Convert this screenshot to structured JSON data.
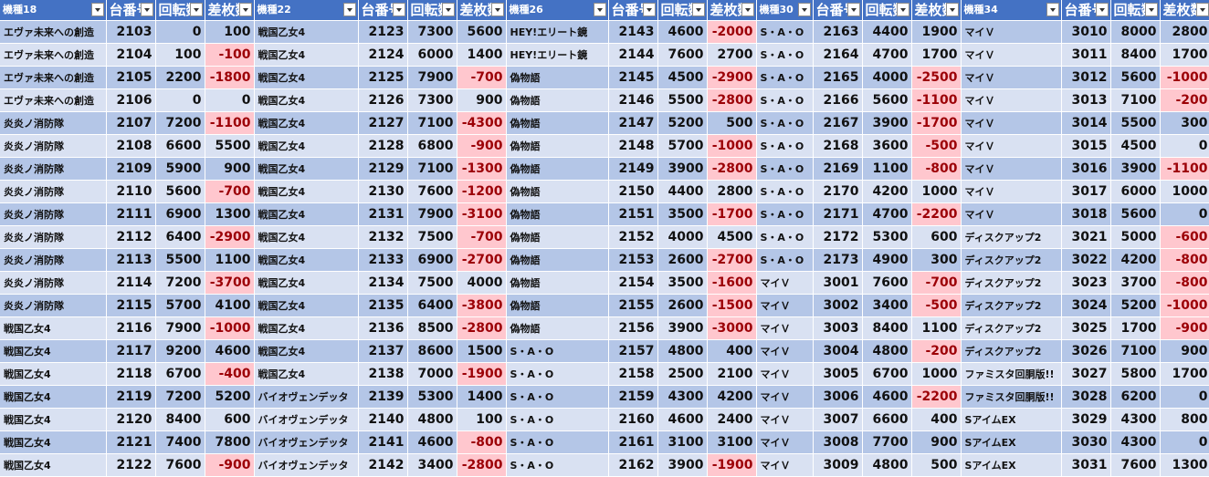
{
  "colors": {
    "header_bg": "#4472c4",
    "band_dark": "#b4c6e7",
    "band_light": "#d9e1f2",
    "negative_fill": "#ffc7ce",
    "negative_text": "#9c0006"
  },
  "headers": [
    {
      "model": "機種18",
      "unit": "台番号",
      "spins": "回転数",
      "diff": "差枚数"
    },
    {
      "model": "機種22",
      "unit": "台番号",
      "spins": "回転数",
      "diff": "差枚数"
    },
    {
      "model": "機種26",
      "unit": "台番号",
      "spins": "回転数",
      "diff": "差枚数"
    },
    {
      "model": "機種30",
      "unit": "台番号",
      "spins": "回転数",
      "diff": "差枚数"
    },
    {
      "model": "機種34",
      "unit": "台番号",
      "spins": "回転数",
      "diff": "差枚数"
    }
  ],
  "rows": [
    [
      [
        "エヴァ未来への創造",
        "2103",
        "0",
        "100"
      ],
      [
        "戦国乙女4",
        "2123",
        "7300",
        "5600"
      ],
      [
        "HEY!エリート鏡",
        "2143",
        "4600",
        "-2000"
      ],
      [
        "S・A・O",
        "2163",
        "4400",
        "1900"
      ],
      [
        "マイＶ",
        "3010",
        "8000",
        "2800"
      ]
    ],
    [
      [
        "エヴァ未来への創造",
        "2104",
        "100",
        "-100"
      ],
      [
        "戦国乙女4",
        "2124",
        "6000",
        "1400"
      ],
      [
        "HEY!エリート鏡",
        "2144",
        "7600",
        "2700"
      ],
      [
        "S・A・O",
        "2164",
        "4700",
        "1700"
      ],
      [
        "マイＶ",
        "3011",
        "8400",
        "1700"
      ]
    ],
    [
      [
        "エヴァ未来への創造",
        "2105",
        "2200",
        "-1800"
      ],
      [
        "戦国乙女4",
        "2125",
        "7900",
        "-700"
      ],
      [
        "偽物語",
        "2145",
        "4500",
        "-2900"
      ],
      [
        "S・A・O",
        "2165",
        "4000",
        "-2500"
      ],
      [
        "マイＶ",
        "3012",
        "5600",
        "-1000"
      ]
    ],
    [
      [
        "エヴァ未来への創造",
        "2106",
        "0",
        "0"
      ],
      [
        "戦国乙女4",
        "2126",
        "7300",
        "900"
      ],
      [
        "偽物語",
        "2146",
        "5500",
        "-2800"
      ],
      [
        "S・A・O",
        "2166",
        "5600",
        "-1100"
      ],
      [
        "マイＶ",
        "3013",
        "7100",
        "-200"
      ]
    ],
    [
      [
        "炎炎ノ消防隊",
        "2107",
        "7200",
        "-1100"
      ],
      [
        "戦国乙女4",
        "2127",
        "7100",
        "-4300"
      ],
      [
        "偽物語",
        "2147",
        "5200",
        "500"
      ],
      [
        "S・A・O",
        "2167",
        "3900",
        "-1700"
      ],
      [
        "マイＶ",
        "3014",
        "5500",
        "300"
      ]
    ],
    [
      [
        "炎炎ノ消防隊",
        "2108",
        "6600",
        "5500"
      ],
      [
        "戦国乙女4",
        "2128",
        "6800",
        "-900"
      ],
      [
        "偽物語",
        "2148",
        "5700",
        "-1000"
      ],
      [
        "S・A・O",
        "2168",
        "3600",
        "-500"
      ],
      [
        "マイＶ",
        "3015",
        "4500",
        "0"
      ]
    ],
    [
      [
        "炎炎ノ消防隊",
        "2109",
        "5900",
        "900"
      ],
      [
        "戦国乙女4",
        "2129",
        "7100",
        "-1300"
      ],
      [
        "偽物語",
        "2149",
        "3900",
        "-2800"
      ],
      [
        "S・A・O",
        "2169",
        "1100",
        "-800"
      ],
      [
        "マイＶ",
        "3016",
        "3900",
        "-1100"
      ]
    ],
    [
      [
        "炎炎ノ消防隊",
        "2110",
        "5600",
        "-700"
      ],
      [
        "戦国乙女4",
        "2130",
        "7600",
        "-1200"
      ],
      [
        "偽物語",
        "2150",
        "4400",
        "2800"
      ],
      [
        "S・A・O",
        "2170",
        "4200",
        "1000"
      ],
      [
        "マイＶ",
        "3017",
        "6000",
        "1000"
      ]
    ],
    [
      [
        "炎炎ノ消防隊",
        "2111",
        "6900",
        "1300"
      ],
      [
        "戦国乙女4",
        "2131",
        "7900",
        "-3100"
      ],
      [
        "偽物語",
        "2151",
        "3500",
        "-1700"
      ],
      [
        "S・A・O",
        "2171",
        "4700",
        "-2200"
      ],
      [
        "マイＶ",
        "3018",
        "5600",
        "0"
      ]
    ],
    [
      [
        "炎炎ノ消防隊",
        "2112",
        "6400",
        "-2900"
      ],
      [
        "戦国乙女4",
        "2132",
        "7500",
        "-700"
      ],
      [
        "偽物語",
        "2152",
        "4000",
        "4500"
      ],
      [
        "S・A・O",
        "2172",
        "5300",
        "600"
      ],
      [
        "ディスクアップ2",
        "3021",
        "5000",
        "-600"
      ]
    ],
    [
      [
        "炎炎ノ消防隊",
        "2113",
        "5500",
        "1100"
      ],
      [
        "戦国乙女4",
        "2133",
        "6900",
        "-2700"
      ],
      [
        "偽物語",
        "2153",
        "2600",
        "-2700"
      ],
      [
        "S・A・O",
        "2173",
        "4900",
        "300"
      ],
      [
        "ディスクアップ2",
        "3022",
        "4200",
        "-800"
      ]
    ],
    [
      [
        "炎炎ノ消防隊",
        "2114",
        "7200",
        "-3700"
      ],
      [
        "戦国乙女4",
        "2134",
        "7500",
        "4000"
      ],
      [
        "偽物語",
        "2154",
        "3500",
        "-1600"
      ],
      [
        "マイＶ",
        "3001",
        "7600",
        "-700"
      ],
      [
        "ディスクアップ2",
        "3023",
        "3700",
        "-800"
      ]
    ],
    [
      [
        "炎炎ノ消防隊",
        "2115",
        "5700",
        "4100"
      ],
      [
        "戦国乙女4",
        "2135",
        "6400",
        "-3800"
      ],
      [
        "偽物語",
        "2155",
        "2600",
        "-1500"
      ],
      [
        "マイＶ",
        "3002",
        "3400",
        "-500"
      ],
      [
        "ディスクアップ2",
        "3024",
        "5200",
        "-1000"
      ]
    ],
    [
      [
        "戦国乙女4",
        "2116",
        "7900",
        "-1000"
      ],
      [
        "戦国乙女4",
        "2136",
        "8500",
        "-2800"
      ],
      [
        "偽物語",
        "2156",
        "3900",
        "-3000"
      ],
      [
        "マイＶ",
        "3003",
        "8400",
        "1100"
      ],
      [
        "ディスクアップ2",
        "3025",
        "1700",
        "-900"
      ]
    ],
    [
      [
        "戦国乙女4",
        "2117",
        "9200",
        "4600"
      ],
      [
        "戦国乙女4",
        "2137",
        "8600",
        "1500"
      ],
      [
        "S・A・O",
        "2157",
        "4800",
        "400"
      ],
      [
        "マイＶ",
        "3004",
        "4800",
        "-200"
      ],
      [
        "ディスクアップ2",
        "3026",
        "7100",
        "900"
      ]
    ],
    [
      [
        "戦国乙女4",
        "2118",
        "6700",
        "-400"
      ],
      [
        "戦国乙女4",
        "2138",
        "7000",
        "-1900"
      ],
      [
        "S・A・O",
        "2158",
        "2500",
        "2100"
      ],
      [
        "マイＶ",
        "3005",
        "6700",
        "1000"
      ],
      [
        "ファミスタ回胴版!!",
        "3027",
        "5800",
        "1700"
      ]
    ],
    [
      [
        "戦国乙女4",
        "2119",
        "7200",
        "5200"
      ],
      [
        "バイオヴェンデッタ",
        "2139",
        "5300",
        "1400"
      ],
      [
        "S・A・O",
        "2159",
        "4300",
        "4200"
      ],
      [
        "マイＶ",
        "3006",
        "4600",
        "-2200"
      ],
      [
        "ファミスタ回胴版!!",
        "3028",
        "6200",
        "0"
      ]
    ],
    [
      [
        "戦国乙女4",
        "2120",
        "8400",
        "600"
      ],
      [
        "バイオヴェンデッタ",
        "2140",
        "4800",
        "100"
      ],
      [
        "S・A・O",
        "2160",
        "4600",
        "2400"
      ],
      [
        "マイＶ",
        "3007",
        "6600",
        "400"
      ],
      [
        "SアイムEX",
        "3029",
        "4300",
        "800"
      ]
    ],
    [
      [
        "戦国乙女4",
        "2121",
        "7400",
        "7800"
      ],
      [
        "バイオヴェンデッタ",
        "2141",
        "4600",
        "-800"
      ],
      [
        "S・A・O",
        "2161",
        "3100",
        "3100"
      ],
      [
        "マイＶ",
        "3008",
        "7700",
        "900"
      ],
      [
        "SアイムEX",
        "3030",
        "4300",
        "0"
      ]
    ],
    [
      [
        "戦国乙女4",
        "2122",
        "7600",
        "-900"
      ],
      [
        "バイオヴェンデッタ",
        "2142",
        "3400",
        "-2800"
      ],
      [
        "S・A・O",
        "2162",
        "3900",
        "-1900"
      ],
      [
        "マイＶ",
        "3009",
        "4800",
        "500"
      ],
      [
        "SアイムEX",
        "3031",
        "7600",
        "1300"
      ]
    ]
  ]
}
